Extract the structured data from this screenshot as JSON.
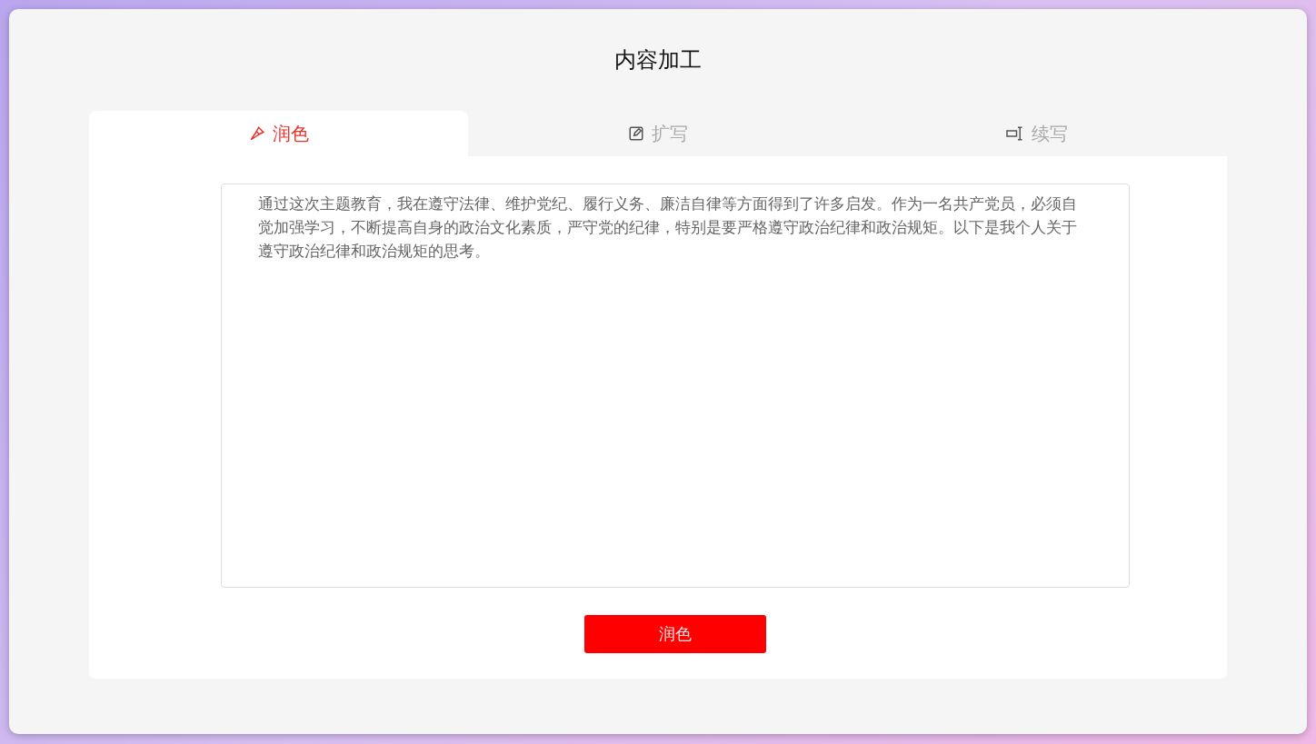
{
  "title": "内容加工",
  "tabs": [
    {
      "label": "润色",
      "kind": "brush",
      "selected": true
    },
    {
      "label": "扩写",
      "kind": "edit",
      "selected": false
    },
    {
      "label": "续写",
      "kind": "cursor",
      "selected": false
    }
  ],
  "editor": {
    "value": "通过这次主题教育，我在遵守法律、维护党纪、履行义务、廉洁自律等方面得到了许多启发。作为一名共产党员，必须自觉加强学习，不断提高自身的政治文化素质，严守党的纪律，特别是要严格遵守政治纪律和政治规矩。以下是我个人关于遵守政治纪律和政治规矩的思考。"
  },
  "submit_button": "润色"
}
